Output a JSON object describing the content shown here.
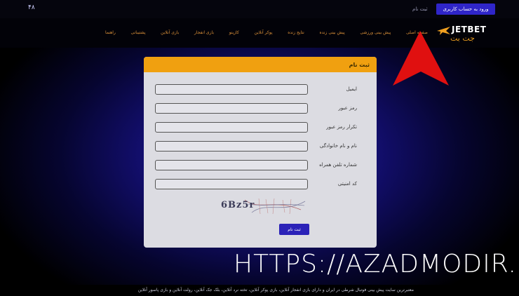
{
  "topbar": {
    "lang": "۴۸",
    "register_link": "ثبت نام",
    "login_button": "ورود به حساب کاربری"
  },
  "logo": {
    "latin": "JETBET",
    "persian": "جت بت"
  },
  "nav": [
    "صفحه اصلی",
    "پیش بینی ورزشی",
    "پیش بینی زنده",
    "نتایج زنده",
    "پوکر آنلاین",
    "کازینو",
    "بازی انفجار",
    "بازی آنلاین",
    "پشتیبانی",
    "راهنما"
  ],
  "form": {
    "title": "ثبت نام",
    "fields": [
      {
        "label": "ایمیل",
        "value": ""
      },
      {
        "label": "رمز عبور",
        "value": ""
      },
      {
        "label": "تکرار رمز عبور",
        "value": ""
      },
      {
        "label": "نام و نام خانوادگی",
        "value": ""
      },
      {
        "label": "شماره تلفن همراه",
        "value": ""
      },
      {
        "label": "کد امنیتی",
        "value": ""
      }
    ],
    "captcha": "6Bz5r",
    "submit": "ثبت نام"
  },
  "watermark": "HTTPS://AZADMODIR.I",
  "footer": "معتبرترین سایت پیش بینی فوتبال شرطی در ایران و دارای بازی انفجار آنلاین، بازی پوکر آنلاین، تخته نرد آنلاین، بلک جک آنلاین، رولت آنلاین و بازی پاسور آنلاین",
  "colors": {
    "accent_orange": "#f0a010",
    "brand_blue": "#2f25c9",
    "arrow_red": "#e01010"
  }
}
